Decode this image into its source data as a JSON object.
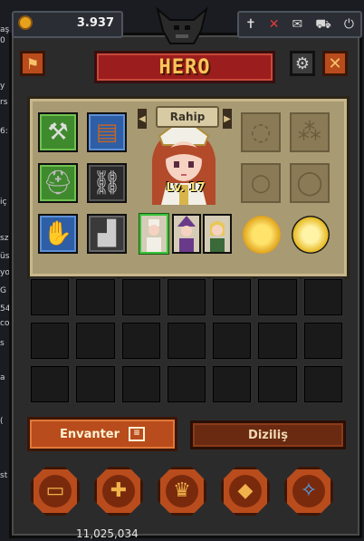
{
  "side_fragments": [
    "aş",
    "0",
    "y",
    "rs",
    "6:",
    "iç",
    "sz",
    "üs",
    "yo",
    "G",
    "54",
    "co",
    "s",
    "a",
    "(",
    "st"
  ],
  "top": {
    "coin_value": "3.937",
    "sys_icons": [
      "sword-icon",
      "mute-icon",
      "mail-icon",
      "cart-icon",
      "power-icon"
    ],
    "sys_glyphs": [
      "✝",
      "✕",
      "✉",
      "⛟",
      "⏻"
    ]
  },
  "window": {
    "title": "HERO"
  },
  "hero": {
    "name": "Rahip",
    "level": "Lv. 17"
  },
  "equipment_left": [
    {
      "name": "mace-icon",
      "glyph": "⚒",
      "color": "green"
    },
    {
      "name": "spellbook-icon",
      "glyph": "📕",
      "color": "blue"
    },
    {
      "name": "chainmail-helmet-icon",
      "glyph": "⛑",
      "color": "green"
    },
    {
      "name": "chainmail-armor-icon",
      "glyph": "⛓",
      "color": "blue"
    },
    {
      "name": "leather-gloves-icon",
      "glyph": "✋",
      "color": "blue"
    },
    {
      "name": "boots-icon",
      "glyph": "👢",
      "color": "green"
    }
  ],
  "equipment_right": [
    {
      "name": "necklace-slot-icon",
      "glyph": "◌"
    },
    {
      "name": "earring-slot-icon",
      "glyph": "⁂"
    },
    {
      "name": "ring-slot-icon",
      "glyph": "○"
    },
    {
      "name": "bracelet-slot-icon",
      "glyph": "◯"
    }
  ],
  "tabs": {
    "inventory": "Envanter",
    "formation": "Diziliş"
  },
  "actions": [
    "chest-icon",
    "cross-icon",
    "crown-icon",
    "box-icon",
    "crystal-icon"
  ],
  "footer": {
    "value": "11,025,034"
  }
}
